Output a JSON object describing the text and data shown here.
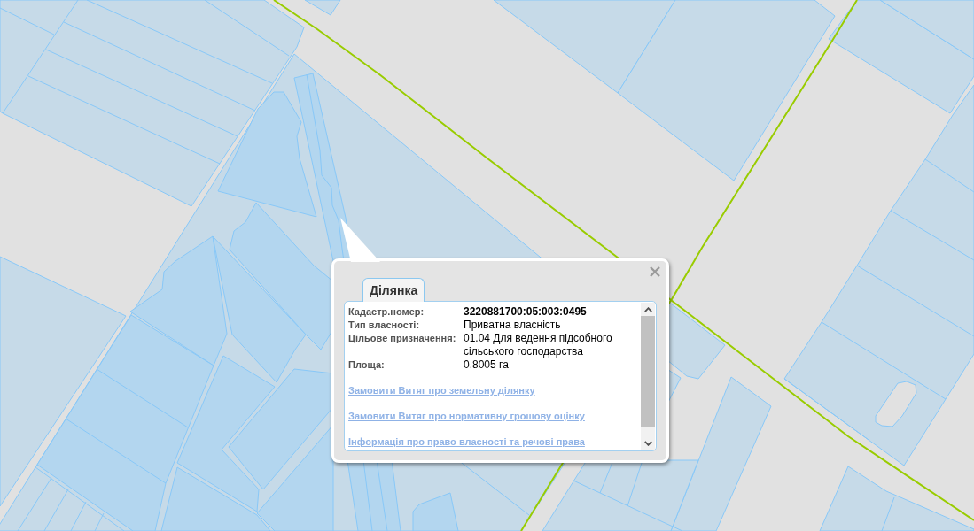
{
  "popup": {
    "tabs": [
      {
        "label": "Ділянка",
        "selected": true
      }
    ],
    "fields": [
      {
        "label": "Кадастр.номер:",
        "value": "3220881700:05:003:0495",
        "kind": "id"
      },
      {
        "label": "Тип власності:",
        "value": "Приватна власність",
        "kind": "text"
      },
      {
        "label": "Цільове призначення:",
        "value": "01.04 Для ведення підсобного сільського господарства",
        "kind": "text"
      },
      {
        "label": "Площа:",
        "value": "0.8005 га",
        "kind": "text"
      }
    ],
    "links": [
      "Замовити Витяг про земельну ділянку",
      "Замовити Витяг про нормативну грошову оцінку",
      "Інформація про право власності та речові права"
    ]
  }
}
